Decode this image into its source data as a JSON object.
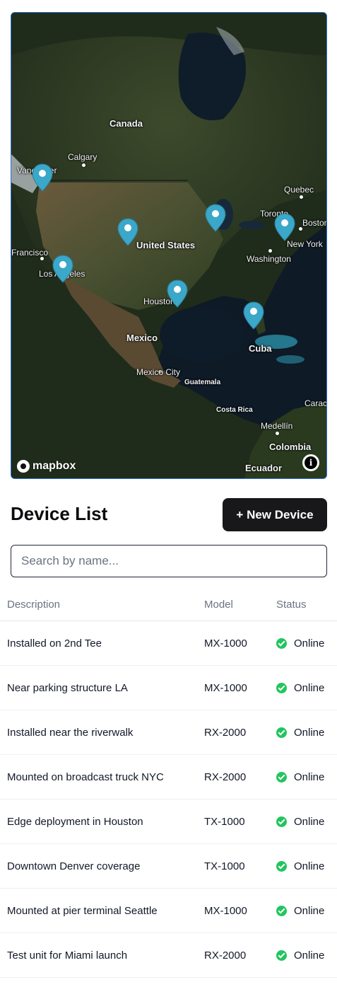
{
  "map": {
    "attribution_logo": "mapbox",
    "info_icon": "info-icon",
    "marker_icon": "map-pin-icon",
    "marker_color": "#3ba7c9",
    "labels": {
      "canada": "Canada",
      "calgary": "Calgary",
      "vancouver": "Vancouver",
      "quebec": "Quebec",
      "toronto": "Toronto",
      "boston": "Boston",
      "new_york": "New York",
      "washington": "Washington",
      "united_states": "United States",
      "san_francisco": "Francisco",
      "los_angeles": "Los Angeles",
      "houston": "Houston",
      "mexico": "Mexico",
      "mexico_city": "Mexico City",
      "guatemala": "Guatemala",
      "cuba": "Cuba",
      "costa_rica": "Costa Rica",
      "medellin": "Medellín",
      "colombia": "Colombia",
      "ecuador": "Ecuador",
      "caracas": "Carac"
    }
  },
  "header": {
    "title": "Device List",
    "new_device_label": "+ New Device"
  },
  "search": {
    "placeholder": "Search by name...",
    "value": ""
  },
  "table": {
    "columns": [
      "Description",
      "Model",
      "Status"
    ],
    "status_color": "#22c55e",
    "rows": [
      {
        "description": "Installed on 2nd Tee",
        "model": "MX-1000",
        "status": "Online"
      },
      {
        "description": "Near parking structure LA",
        "model": "MX-1000",
        "status": "Online"
      },
      {
        "description": "Installed near the riverwalk",
        "model": "RX-2000",
        "status": "Online"
      },
      {
        "description": "Mounted on broadcast truck NYC",
        "model": "RX-2000",
        "status": "Online"
      },
      {
        "description": "Edge deployment in Houston",
        "model": "TX-1000",
        "status": "Online"
      },
      {
        "description": "Downtown Denver coverage",
        "model": "TX-1000",
        "status": "Online"
      },
      {
        "description": "Mounted at pier terminal Seattle",
        "model": "MX-1000",
        "status": "Online"
      },
      {
        "description": "Test unit for Miami launch",
        "model": "RX-2000",
        "status": "Online"
      }
    ]
  }
}
